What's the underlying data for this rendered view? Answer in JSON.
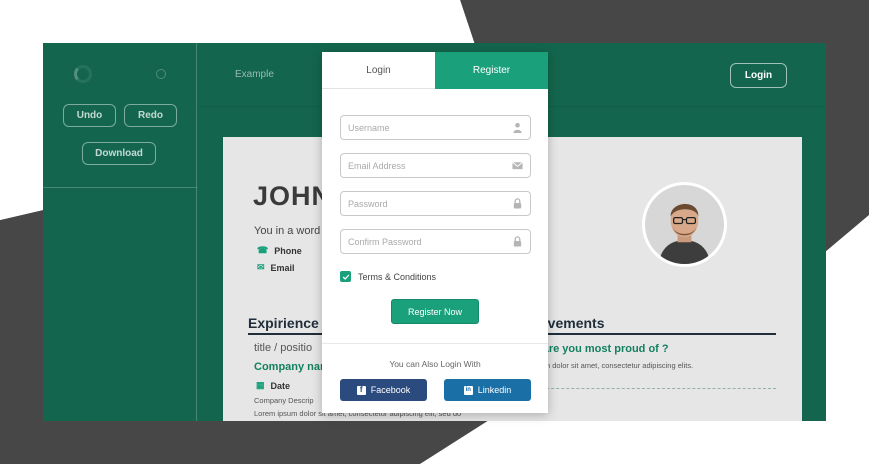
{
  "nav": {
    "example_link": "Example",
    "login_button": "Login"
  },
  "sidebar": {
    "undo_label": "Undo",
    "redo_label": "Redo",
    "download_label": "Download"
  },
  "resume": {
    "name": "JOHN",
    "tagline": "You in a word",
    "phone_label": "Phone",
    "email_label": "Email",
    "experience_heading": "Expirience",
    "achievements_heading": "ievements",
    "job_title": "title / positio",
    "company": "Company nar",
    "date_label": "Date",
    "company_desc": "Company Descrip",
    "lorem_left": "Lorem ipsum dolor sit amet, consectetur adipiscing elit, sed do",
    "achievement_question": "t are you most proud of ?",
    "lorem_right": "sum dolor sit amet, consectetur adipiscing elits."
  },
  "modal": {
    "tab_login": "Login",
    "tab_register": "Register",
    "username_placeholder": "Username",
    "email_placeholder": "Email Address",
    "password_placeholder": "Password",
    "confirm_placeholder": "Confirm Password",
    "terms_label": "Terms & Conditions",
    "terms_checked": true,
    "register_button": "Register Now",
    "also_login_text": "You can Also Login With",
    "facebook_label": "Facebook",
    "linkedin_label": "Linkedin"
  },
  "icons": {
    "user": "user-icon",
    "email": "envelope-icon",
    "password": "lock-icon",
    "confirm": "lock-icon",
    "phone": "phone-icon",
    "mail": "mail-icon",
    "calendar": "calendar-icon",
    "check": "check-icon",
    "facebook": "facebook-icon",
    "linkedin": "linkedin-icon"
  },
  "colors": {
    "app_bg": "#13664d",
    "accent": "#1aa17c",
    "facebook": "#2b4a7e",
    "linkedin": "#1a6fa6",
    "backdrop_dark": "#474747"
  }
}
